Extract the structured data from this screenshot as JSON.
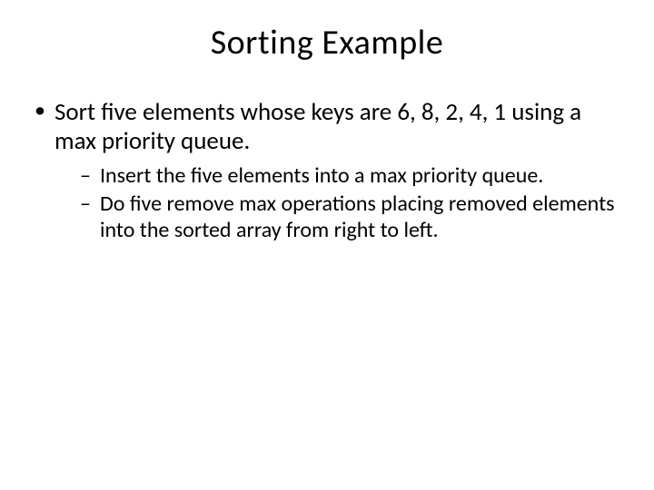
{
  "title": "Sorting Example",
  "bullets": {
    "l1": [
      {
        "text": "Sort five elements whose keys are 6, 8, 2, 4, 1 using a max priority queue.",
        "l2": [
          "Insert the five elements into a max priority queue.",
          "Do five remove max operations placing removed elements into the sorted array from right to left."
        ]
      }
    ]
  }
}
